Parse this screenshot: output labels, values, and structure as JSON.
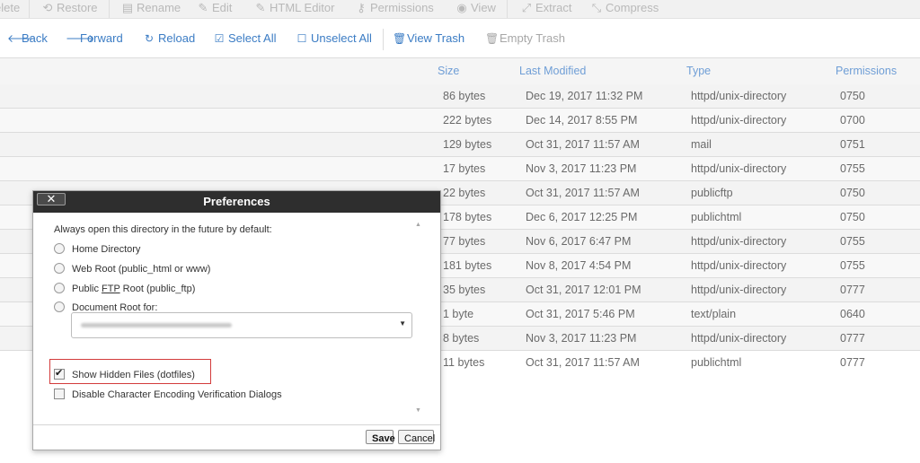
{
  "toolbar_top": {
    "items": [
      {
        "label": "elete",
        "icon": ""
      },
      {
        "label": "Restore",
        "icon": "restore-icon"
      },
      {
        "label": "Rename",
        "icon": "rename-icon"
      },
      {
        "label": "Edit",
        "icon": "edit-icon"
      },
      {
        "label": "HTML Editor",
        "icon": "html-editor-icon"
      },
      {
        "label": "Permissions",
        "icon": "key-icon"
      },
      {
        "label": "View",
        "icon": "eye-icon"
      },
      {
        "label": "Extract",
        "icon": "extract-icon"
      },
      {
        "label": "Compress",
        "icon": "compress-icon"
      }
    ]
  },
  "toolbar_nav": {
    "back": "Back",
    "forward": "Forward",
    "reload": "Reload",
    "select_all": "Select All",
    "unselect_all": "Unselect All",
    "view_trash": "View Trash",
    "empty_trash": "Empty Trash"
  },
  "columns": {
    "size": "Size",
    "last_modified": "Last Modified",
    "type": "Type",
    "permissions": "Permissions"
  },
  "files": [
    {
      "size": "86 bytes",
      "modified": "Dec 19, 2017 11:32 PM",
      "type": "httpd/unix-directory",
      "perms": "0750"
    },
    {
      "size": "222 bytes",
      "modified": "Dec 14, 2017 8:55 PM",
      "type": "httpd/unix-directory",
      "perms": "0700"
    },
    {
      "size": "129 bytes",
      "modified": "Oct 31, 2017 11:57 AM",
      "type": "mail",
      "perms": "0751"
    },
    {
      "size": "17 bytes",
      "modified": "Nov 3, 2017 11:23 PM",
      "type": "httpd/unix-directory",
      "perms": "0755"
    },
    {
      "size": "22 bytes",
      "modified": "Oct 31, 2017 11:57 AM",
      "type": "publicftp",
      "perms": "0750"
    },
    {
      "size": "178 bytes",
      "modified": "Dec 6, 2017 12:25 PM",
      "type": "publichtml",
      "perms": "0750"
    },
    {
      "size": "77 bytes",
      "modified": "Nov 6, 2017 6:47 PM",
      "type": "httpd/unix-directory",
      "perms": "0755"
    },
    {
      "size": "181 bytes",
      "modified": "Nov 8, 2017 4:54 PM",
      "type": "httpd/unix-directory",
      "perms": "0755"
    },
    {
      "size": "35 bytes",
      "modified": "Oct 31, 2017 12:01 PM",
      "type": "httpd/unix-directory",
      "perms": "0777"
    },
    {
      "size": "1 byte",
      "modified": "Oct 31, 2017 5:46 PM",
      "type": "text/plain",
      "perms": "0640"
    },
    {
      "size": "8 bytes",
      "modified": "Nov 3, 2017 11:23 PM",
      "type": "httpd/unix-directory",
      "perms": "0777"
    },
    {
      "size": "11 bytes",
      "modified": "Oct 31, 2017 11:57 AM",
      "type": "publichtml",
      "perms": "0777"
    }
  ],
  "dialog": {
    "title": "Preferences",
    "close_label": "✕",
    "open_dir_label": "Always open this directory in the future by default:",
    "radio_home": "Home Directory",
    "radio_web_root": "Web Root (public_html or www)",
    "radio_public_pre": "Public ",
    "radio_public_ftp": "FTP",
    "radio_public_post": " Root (public_ftp)",
    "radio_doc_root": "Document Root for:",
    "show_hidden": "Show Hidden Files (dotfiles)",
    "show_hidden_checked": true,
    "disable_encoding": "Disable Character Encoding Verification Dialogs",
    "disable_encoding_checked": false,
    "save": "Save",
    "cancel": "Cancel"
  }
}
